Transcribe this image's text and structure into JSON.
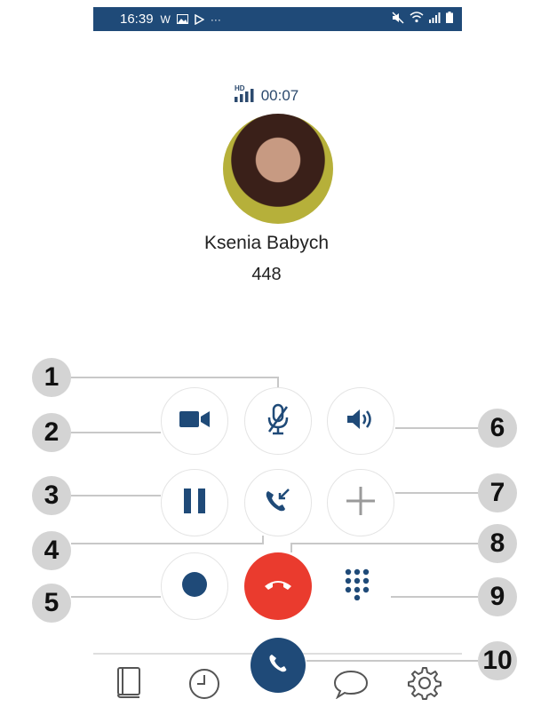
{
  "status_bar": {
    "time": "16:39",
    "carrier_glyph": "W",
    "more": "···"
  },
  "call": {
    "duration": "00:07",
    "quality_badge": "HD",
    "contact_name": "Ksenia Babych",
    "contact_number": "448"
  },
  "callouts": [
    "1",
    "2",
    "3",
    "4",
    "5",
    "6",
    "7",
    "8",
    "9",
    "10"
  ],
  "colors": {
    "brand": "#1f4a78",
    "end_call": "#ea3b2e",
    "callout_bg": "#d4d4d4"
  }
}
